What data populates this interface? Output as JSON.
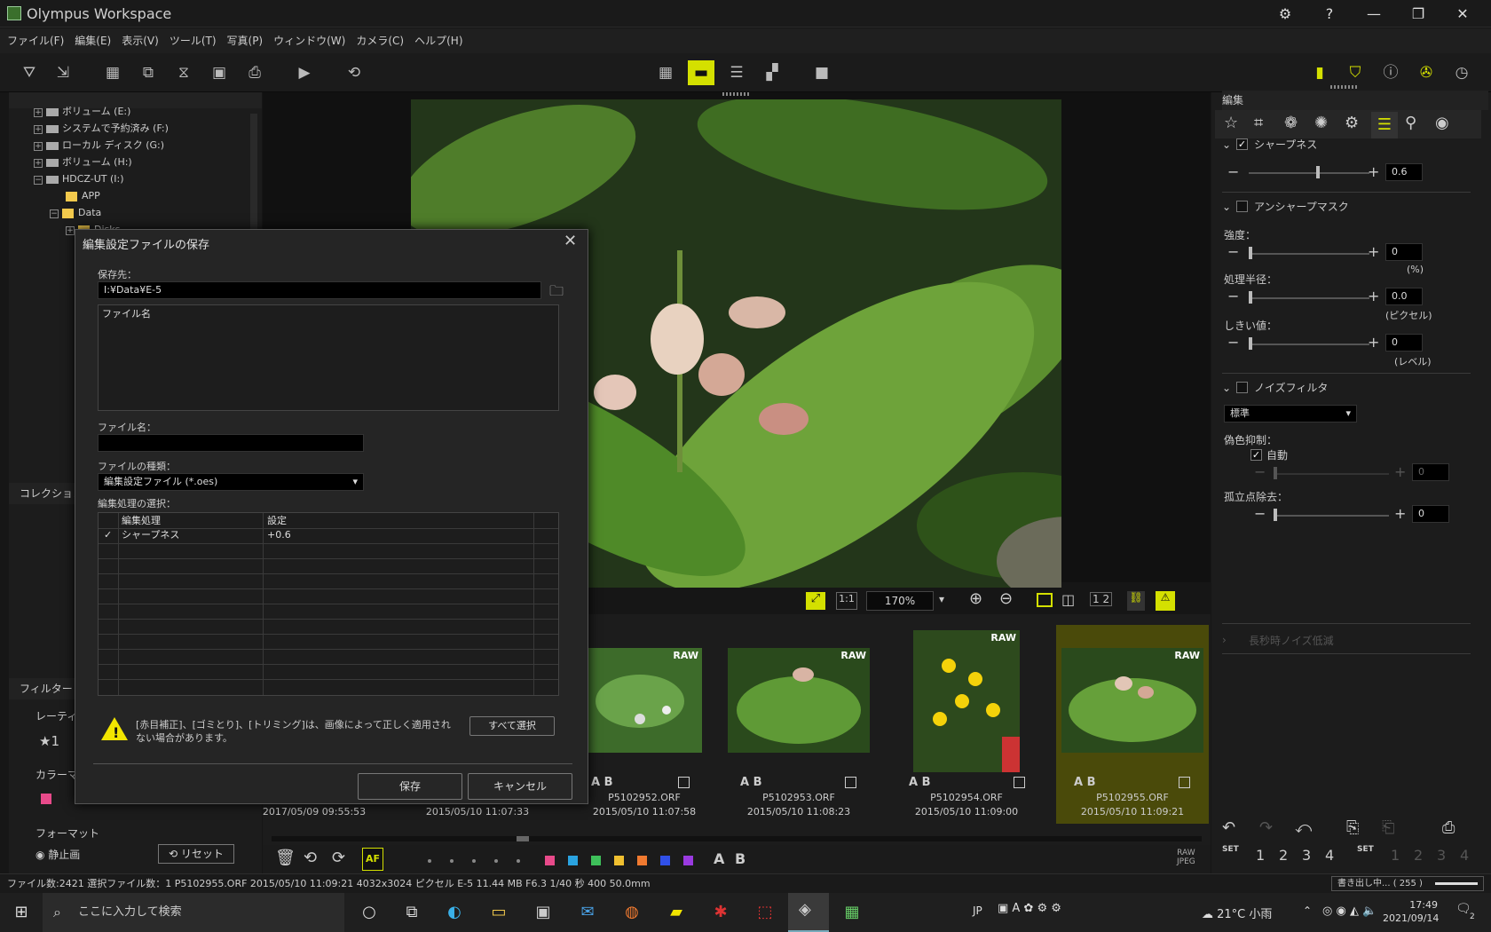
{
  "app": {
    "title": "Olympus Workspace"
  },
  "menu": [
    "ファイル(F)",
    "編集(E)",
    "表示(V)",
    "ツール(T)",
    "写真(P)",
    "ウィンドウ(W)",
    "カメラ(C)",
    "ヘルプ(H)"
  ],
  "tree": {
    "items": [
      {
        "label": "ボリューム (E:)",
        "type": "drive"
      },
      {
        "label": "システムで予約済み (F:)",
        "type": "drive"
      },
      {
        "label": "ローカル ディスク (G:)",
        "type": "drive"
      },
      {
        "label": "ボリューム (H:)",
        "type": "drive"
      },
      {
        "label": "HDCZ-UT (I:)",
        "type": "drive"
      },
      {
        "label": "APP",
        "type": "folder"
      },
      {
        "label": "Data",
        "type": "folder"
      },
      {
        "label": "Disks",
        "type": "folder"
      }
    ]
  },
  "left": {
    "collection": "コレクション",
    "filter": "フィルター",
    "rating": "レーティング",
    "rating_value": "★1",
    "color_mark": "カラーマーク",
    "format": "フォーマット",
    "still": "静止画",
    "reset": "リセット"
  },
  "dialog": {
    "title": "編集設定ファイルの保存",
    "save_to_label": "保存先：",
    "save_to_value": "I:¥Data¥E-5",
    "file_list_header": "ファイル名",
    "file_name_label": "ファイル名：",
    "file_name_value": "",
    "file_type_label": "ファイルの種類：",
    "file_type_value": "編集設定ファイル (*.oes)",
    "selection_label": "編集処理の選択：",
    "col_process": "編集処理",
    "col_setting": "設定",
    "rows": [
      {
        "checked": true,
        "process": "シャープネス",
        "setting": "+0.6"
      }
    ],
    "warning": "[赤目補正]、[ゴミとり]、[トリミング]は、画像によって正しく適用されない場合があります。",
    "select_all": "すべて選択",
    "save": "保存",
    "cancel": "キャンセル"
  },
  "viewer": {
    "zoom": "170%"
  },
  "filmstrip": {
    "items": [
      {
        "name": "",
        "date": "2017/05/09 09:55:53",
        "ab": "",
        "raw": false
      },
      {
        "name": "",
        "date": "2015/05/10 11:07:33",
        "ab": "",
        "raw": false
      },
      {
        "name": "P5102952.ORF",
        "date": "2015/05/10 11:07:58",
        "ab": "A B",
        "raw": true
      },
      {
        "name": "P5102953.ORF",
        "date": "2015/05/10 11:08:23",
        "ab": "A B",
        "raw": true
      },
      {
        "name": "P5102954.ORF",
        "date": "2015/05/10 11:09:00",
        "ab": "A B",
        "raw": true
      },
      {
        "name": "P5102955.ORF",
        "date": "2015/05/10 11:09:21",
        "ab": "A B",
        "raw": true
      }
    ],
    "raw_badge": "RAW"
  },
  "right": {
    "title": "編集",
    "sharpness": "シャープネス",
    "sharpness_value": "0.6",
    "unsharp": "アンシャープマスク",
    "strength": "強度：",
    "strength_value": "0",
    "strength_unit": "(%)",
    "radius": "処理半径：",
    "radius_value": "0.0",
    "radius_unit": "(ピクセル)",
    "threshold": "しきい値：",
    "threshold_value": "0",
    "threshold_unit": "(レベル)",
    "noise": "ノイズフィルタ",
    "noise_mode": "標準",
    "false_color": "偽色抑制：",
    "auto": "自動",
    "false_color_value": "0",
    "isolated": "孤立点除去：",
    "isolated_value": "0",
    "long_exposure": "長秒時ノイズ低減",
    "set_label": "SET",
    "nums": [
      "1",
      "2",
      "3",
      "4"
    ]
  },
  "status": {
    "text": "ファイル数:2421  選択ファイル数：1  P5102955.ORF  2015/05/10 11:09:21  4032x3024 ピクセル  E-5  11.44 MB  F6.3  1/40 秒  400  50.0mm",
    "progress": "書き出し中... ( 255 )"
  },
  "taskbar": {
    "search": "ここに入力して検索",
    "weather": "21°C 小雨",
    "lang": "JP",
    "time": "17:49",
    "date": "2021/09/14",
    "notif": "2"
  },
  "colors": {
    "accent": "#d4e000",
    "selected_thumb_bg": "#4a4a0a"
  }
}
